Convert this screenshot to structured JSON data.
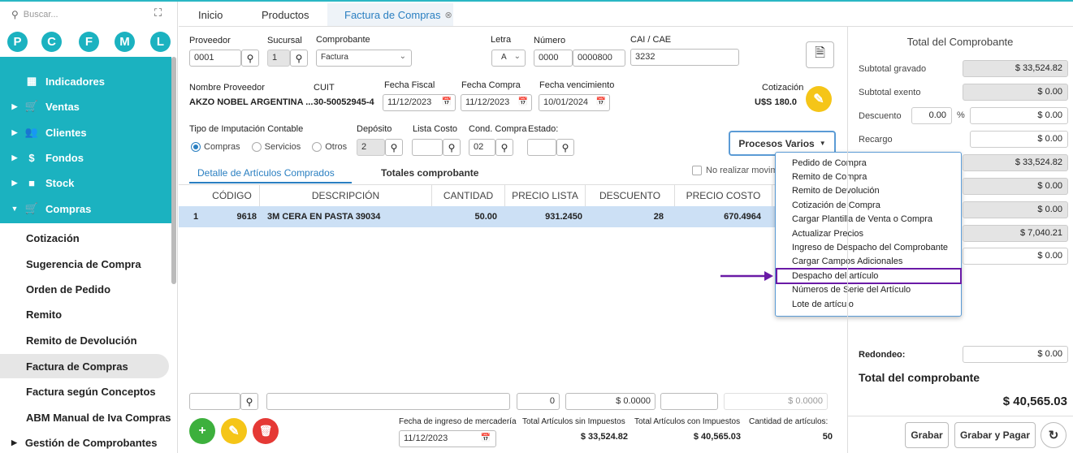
{
  "sidebar": {
    "search_placeholder": "Buscar...",
    "shortcuts": [
      "P",
      "C",
      "F",
      "M",
      "L"
    ],
    "nav": [
      "Indicadores",
      "Ventas",
      "Clientes",
      "Fondos",
      "Stock",
      "Compras"
    ],
    "sub": [
      "Cotización",
      "Sugerencia de Compra",
      "Orden de Pedido",
      "Remito",
      "Remito de Devolución",
      "Factura de Compras",
      "Factura según Conceptos",
      "ABM Manual de Iva Compras",
      "Gestión de Comprobantes"
    ]
  },
  "tabs": [
    "Inicio",
    "Productos",
    "Factura de Compras"
  ],
  "form": {
    "proveedor_label": "Proveedor",
    "proveedor": "0001",
    "sucursal_label": "Sucursal",
    "sucursal": "1",
    "comprobante_label": "Comprobante",
    "comprobante": "Factura",
    "letra_label": "Letra",
    "letra": "A",
    "numero_label": "Número",
    "numero1": "0000",
    "numero2": "0000800",
    "cai_label": "CAI / CAE",
    "cai": "3232",
    "nombre_label": "Nombre Proveedor",
    "nombre": "AKZO NOBEL ARGENTINA ...",
    "cuit_label": "CUIT",
    "cuit": "30-50052945-4",
    "ffiscal_label": "Fecha Fiscal",
    "ffiscal": "11/12/2023",
    "fcompra_label": "Fecha Compra",
    "fcompra": "11/12/2023",
    "fvenc_label": "Fecha vencimiento",
    "fvenc": "10/01/2024",
    "cotiz_label": "Cotización",
    "cotiz": "U$S  180.0",
    "tipo_label": "Tipo de Imputación Contable",
    "radio": [
      "Compras",
      "Servicios",
      "Otros"
    ],
    "deposito_label": "Depósito",
    "deposito": "2",
    "lista_label": "Lista Costo",
    "cond_label": "Cond. Compra",
    "cond": "02",
    "estado_label": "Estado:",
    "procesos": "Procesos Varios"
  },
  "subtabs": [
    "Detalle de Artículos Comprados",
    "Totales comprobante"
  ],
  "no_realizar": "No realizar movim",
  "grid": {
    "headers": [
      "CÓDIGO",
      "DESCRIPCIÓN",
      "CANTIDAD",
      "PRECIO LISTA",
      "DESCUENTO",
      "PRECIO COSTO"
    ],
    "row": [
      "1",
      "9618",
      "3M CERA EN PASTA 39034",
      "50.00",
      "931.2450",
      "28",
      "670.4964"
    ]
  },
  "menu": [
    "Pedido de Compra",
    "Remito de Compra",
    "Remito de Devolución",
    "Cotización de Compra",
    "Cargar Plantilla de Venta o Compra",
    "Actualizar Precios",
    "Ingreso de Despacho del Comprobante",
    "Cargar Campos Adicionales",
    "Despacho del artículo",
    "Números de Serie del Artículo",
    "Lote de artículo"
  ],
  "footer": {
    "qty": "0",
    "price": "$ 0.0000",
    "price2": "$ 0.0000",
    "fecha_label": "Fecha de ingreso de mercadería",
    "fecha": "11/12/2023",
    "sin_label": "Total Artículos sin Impuestos",
    "sin": "$ 33,524.82",
    "con_label": "Total Artículos con Impuestos",
    "con": "$ 40,565.03",
    "cant_label": "Cantidad de artículos:",
    "cant": "50"
  },
  "totals": {
    "title": "Total del Comprobante",
    "gravado_label": "Subtotal gravado",
    "gravado": "$ 33,524.82",
    "exento_label": "Subtotal exento",
    "exento": "$ 0.00",
    "desc_label": "Descuento",
    "desc_pct": "0.00",
    "pct": "%",
    "desc": "$ 0.00",
    "recargo_label": "Recargo",
    "recargo": "$ 0.00",
    "v5": "$ 33,524.82",
    "v6": "$ 0.00",
    "v7": "$ 0.00",
    "v8": "$ 7,040.21",
    "v9": "$ 0.00",
    "redondeo_label": "Redondeo:",
    "redondeo": "$ 0.00",
    "total_label": "Total del comprobante",
    "total": "$ 40,565.03",
    "grabar": "Grabar",
    "grabar_pagar": "Grabar y Pagar"
  },
  "colors": {
    "teal": "#1bb2c0",
    "accent": "#2a7fc1",
    "highlight": "#cce0f5",
    "arrow": "#6a1aa6",
    "yellow": "#f5c518",
    "green": "#3db03d",
    "red": "#e53935"
  }
}
